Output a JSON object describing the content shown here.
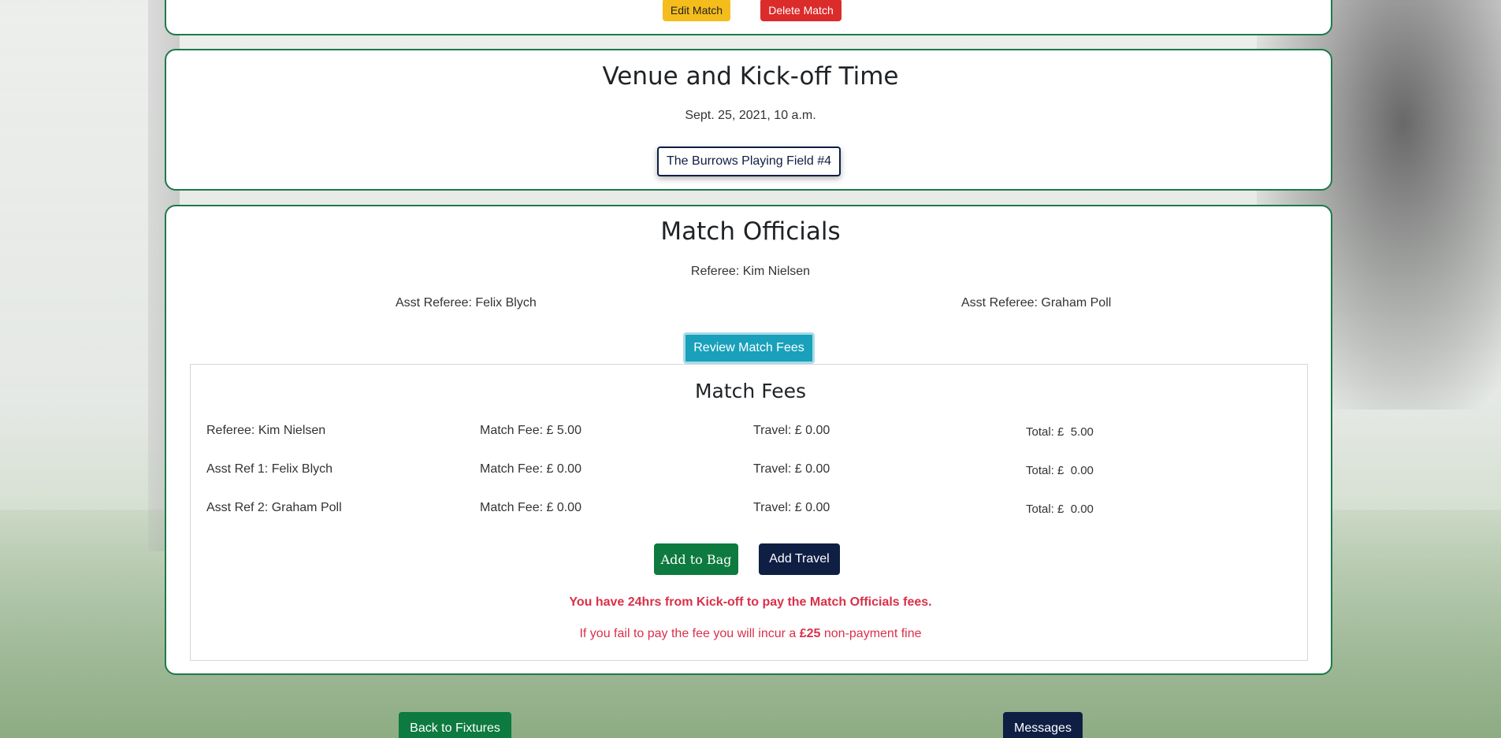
{
  "top_actions": {
    "edit_label": "Edit Match",
    "delete_label": "Delete Match"
  },
  "venue": {
    "title": "Venue and Kick-off Time",
    "date": "Sept. 25, 2021, 10 a.m.",
    "field_label": "The Burrows Playing Field #4"
  },
  "officials": {
    "title": "Match Officials",
    "referee": "Referee: Kim Nielsen",
    "asst_1": "Asst Referee: Felix Blych",
    "asst_2": "Asst Referee: Graham Poll",
    "review_label": "Review Match Fees"
  },
  "fees": {
    "title": "Match Fees",
    "rows": [
      {
        "official": "Referee: Kim Nielsen",
        "match_fee": "Match Fee: £ 5.00",
        "travel": "Travel: £ 0.00",
        "total": "Total: £  5.00"
      },
      {
        "official": "Asst Ref 1: Felix Blych",
        "match_fee": "Match Fee: £ 0.00",
        "travel": "Travel: £ 0.00",
        "total": "Total: £  0.00"
      },
      {
        "official": "Asst Ref 2: Graham Poll",
        "match_fee": "Match Fee: £ 0.00",
        "travel": "Travel: £ 0.00",
        "total": "Total: £  0.00"
      }
    ],
    "add_to_bag_label": "Add to Bag",
    "add_travel_label": "Add Travel",
    "warning": "You have 24hrs from Kick-off to pay the Match Officials fees.",
    "fine_prefix": "If you fail to pay the fee you will incur a ",
    "fine_amount": "£25",
    "fine_suffix": " non-payment fine"
  },
  "footer": {
    "back_label": "Back to Fixtures",
    "messages_label": "Messages"
  },
  "colors": {
    "card_border": "#1d7a4a",
    "green_button": "#0d7a3f",
    "navy_button": "#0f1f44",
    "teal_button": "#19a0bb",
    "edit_button": "#f5bd1c",
    "delete_button": "#dc2b2b",
    "warning_text": "#d9304a"
  }
}
